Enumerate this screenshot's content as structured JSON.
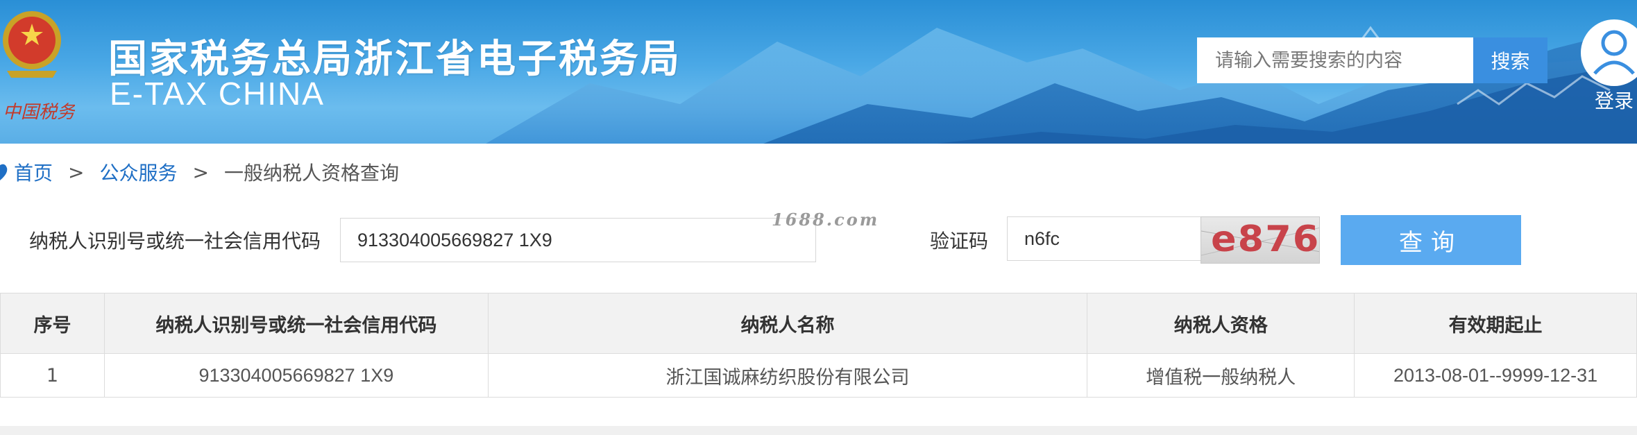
{
  "header": {
    "title": "国家税务总局浙江省电子税务局",
    "subtitle": "E-TAX CHINA",
    "emblem_text": "中国税务",
    "search": {
      "placeholder": "请输入需要搜索的内容",
      "button_label": "搜索"
    },
    "login_label": "登录"
  },
  "breadcrumb": {
    "home": "首页",
    "separator": ">",
    "section": "公众服务",
    "current": "一般纳税人资格查询"
  },
  "form": {
    "taxpayer_id_label": "纳税人识别号或统一社会信用代码",
    "taxpayer_id_value": "913304005669827 1X9",
    "captcha_label": "验证码",
    "captcha_value": "n6fc",
    "captcha_image_text": "e876",
    "query_button_label": "查询"
  },
  "watermark": "1688.com",
  "table": {
    "columns": [
      "序号",
      "纳税人识别号或统一社会信用代码",
      "纳税人名称",
      "纳税人资格",
      "有效期起止"
    ],
    "rows": [
      [
        "1",
        "913304005669827 1X9",
        "浙江国诚麻纺织股份有限公司",
        "增值税一般纳税人",
        "2013-08-01--9999-12-31"
      ]
    ]
  },
  "colors": {
    "banner_top": "#2a8fd6",
    "search_button": "#3a8fe0",
    "query_button": "#5aaaf0",
    "link": "#1f6fc5",
    "captcha_text": "#c8434a"
  }
}
